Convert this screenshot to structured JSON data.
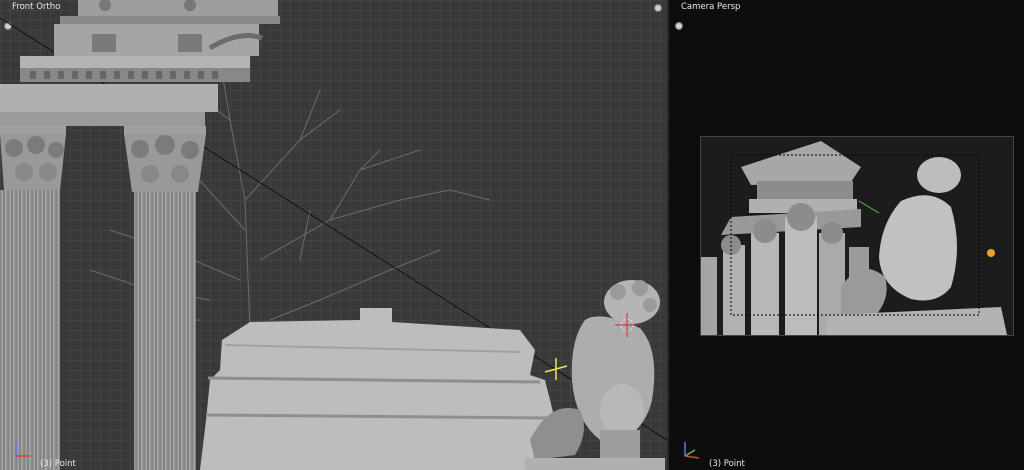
{
  "viewports": {
    "left": {
      "title": "Front Ortho",
      "status": "(3) Point"
    },
    "right": {
      "title": "Camera Persp",
      "status": "(3) Point"
    }
  },
  "colors": {
    "viewport_grid_bg": "#393939",
    "camera_bg": "#0d0d0d",
    "marble": "#a9a9a9",
    "axis_x": "#e23b3b",
    "axis_y": "#57c04a",
    "axis_z": "#4f78ff",
    "light_yellow": "#f2e25a"
  },
  "icons": {
    "viewport_toggle": "corner-dot-icon",
    "axes": "axis-gizmo-icon",
    "crosshair": "3d-cursor-icon",
    "light": "lamp-icon"
  }
}
